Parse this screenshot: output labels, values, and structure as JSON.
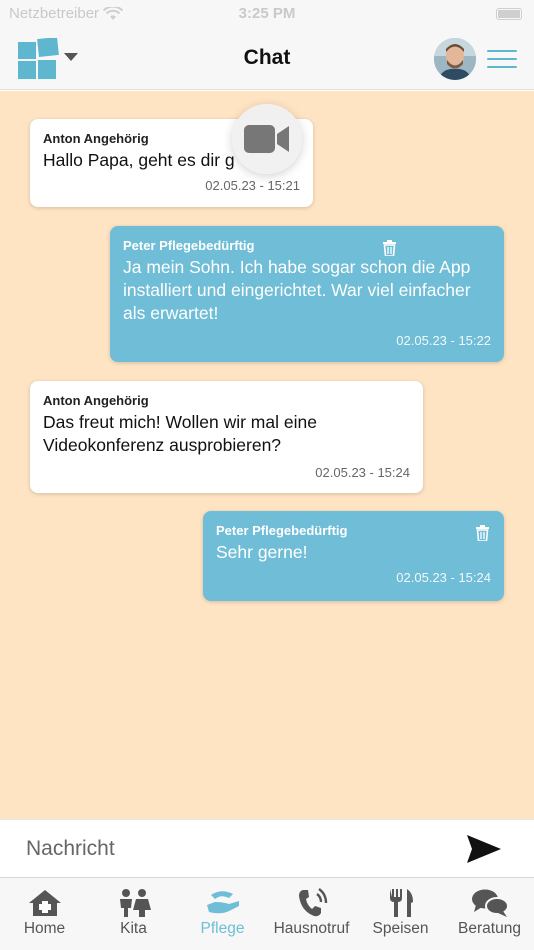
{
  "status_bar": {
    "carrier": "Netzbetreiber",
    "time": "3:25 PM"
  },
  "header": {
    "title": "Chat"
  },
  "chat": {
    "messages": [
      {
        "sender": "Anton Angehörig",
        "text": "Hallo Papa, geht es dir g",
        "time": "02.05.23 - 15:21",
        "direction": "incoming"
      },
      {
        "sender": "Peter Pflegebedürftig",
        "text": "Ja mein Sohn. Ich habe sogar schon die App installiert und eingerichtet. War viel einfacher als erwartet!",
        "time": "02.05.23 - 15:22",
        "direction": "outgoing"
      },
      {
        "sender": "Anton Angehörig",
        "text": "Das freut mich! Wollen wir mal eine Videokonferenz ausprobieren?",
        "time": "02.05.23 - 15:24",
        "direction": "incoming"
      },
      {
        "sender": "Peter Pflegebedürftig",
        "text": "Sehr gerne!",
        "time": "02.05.23 - 15:24",
        "direction": "outgoing"
      }
    ]
  },
  "composer": {
    "placeholder": "Nachricht",
    "value": ""
  },
  "tabs": [
    {
      "label": "Home",
      "icon": "home-icon",
      "active": false
    },
    {
      "label": "Kita",
      "icon": "children-icon",
      "active": false
    },
    {
      "label": "Pflege",
      "icon": "care-hand-icon",
      "active": true
    },
    {
      "label": "Hausnotruf",
      "icon": "phone-call-icon",
      "active": false
    },
    {
      "label": "Speisen",
      "icon": "cutlery-icon",
      "active": false
    },
    {
      "label": "Beratung",
      "icon": "chat-bubbles-icon",
      "active": false
    }
  ],
  "colors": {
    "chat_background": "#ffe4c4",
    "outgoing_bubble": "#6fbdd6",
    "accent": "#6fbdd6",
    "incoming_bubble": "#ffffff"
  }
}
